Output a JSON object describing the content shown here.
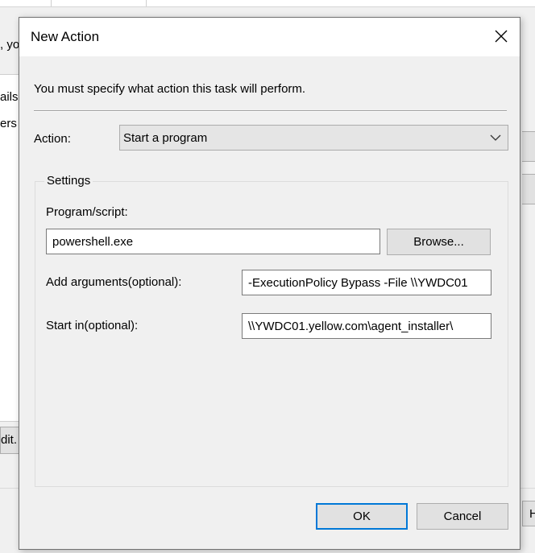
{
  "background": {
    "fragments": {
      "top_right_text": ", yo",
      "row1_text": "ails",
      "row2_text": "ers",
      "edit_button": "dit.",
      "right_button_letter": "H"
    }
  },
  "dialog": {
    "title": "New Action",
    "close_icon": "close-icon",
    "instruction": "You must specify what action this task will perform.",
    "action": {
      "label": "Action:",
      "selected": "Start a program"
    },
    "settings": {
      "legend": "Settings",
      "program": {
        "label": "Program/script:",
        "value": "powershell.exe",
        "browse_label": "Browse..."
      },
      "arguments": {
        "label": "Add arguments(optional):",
        "value": "-ExecutionPolicy Bypass -File \\\\YWDC01"
      },
      "start_in": {
        "label": "Start in(optional):",
        "value": "\\\\YWDC01.yellow.com\\agent_installer\\"
      }
    },
    "buttons": {
      "ok": "OK",
      "cancel": "Cancel"
    }
  },
  "colors": {
    "accent_focus": "#0078d7",
    "titlebar": "#ffffff",
    "dialog_bg": "#f0f0f0"
  }
}
